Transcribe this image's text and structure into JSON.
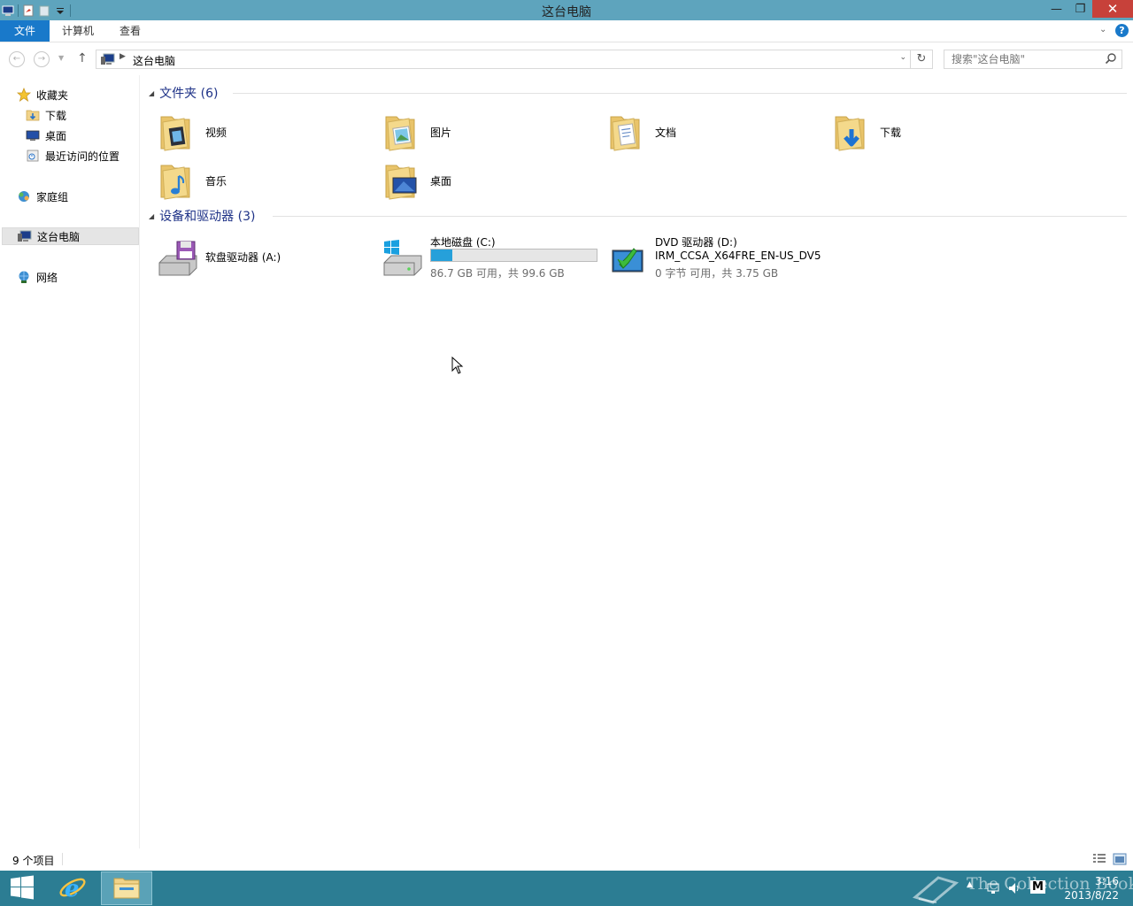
{
  "window": {
    "title": "这台电脑"
  },
  "ribbon": {
    "tabs": [
      {
        "label": "文件"
      },
      {
        "label": "计算机"
      },
      {
        "label": "查看"
      }
    ],
    "help_label": "?"
  },
  "address": {
    "path": "这台电脑",
    "search_placeholder": "搜索\"这台电脑\""
  },
  "nav_pane": {
    "favorites": {
      "label": "收藏夹",
      "items": [
        {
          "label": "下载"
        },
        {
          "label": "桌面"
        },
        {
          "label": "最近访问的位置"
        }
      ]
    },
    "homegroup": {
      "label": "家庭组"
    },
    "this_pc": {
      "label": "这台电脑"
    },
    "network": {
      "label": "网络"
    }
  },
  "folders_group": {
    "title": "文件夹 (6)",
    "items": [
      {
        "label": "视频",
        "icon": "videos-folder-icon"
      },
      {
        "label": "图片",
        "icon": "pictures-folder-icon"
      },
      {
        "label": "文档",
        "icon": "documents-folder-icon"
      },
      {
        "label": "下载",
        "icon": "downloads-folder-icon"
      },
      {
        "label": "音乐",
        "icon": "music-folder-icon"
      },
      {
        "label": "桌面",
        "icon": "desktop-folder-icon"
      }
    ]
  },
  "devices_group": {
    "title": "设备和驱动器 (3)",
    "floppy": {
      "label": "软盘驱动器 (A:)"
    },
    "local_disk": {
      "label": "本地磁盘 (C:)",
      "space": "86.7 GB 可用，共 99.6 GB",
      "used_fraction": 0.13
    },
    "dvd": {
      "label": "DVD 驱动器 (D:)",
      "volume": "IRM_CCSA_X64FRE_EN-US_DV5",
      "space": "0 字节 可用，共 3.75 GB"
    }
  },
  "status": {
    "item_count": "9 个项目"
  },
  "taskbar": {
    "watermark": "The Collection Book",
    "time": "3:16",
    "date": "2013/8/22",
    "ime": "M"
  },
  "colors": {
    "titlebar": "#5ea4bd",
    "file_tab": "#1979ca",
    "taskbar": "#2c7d93",
    "close_button": "#c7413a",
    "progress_fill": "#26a0da",
    "group_title": "#1e3287"
  }
}
